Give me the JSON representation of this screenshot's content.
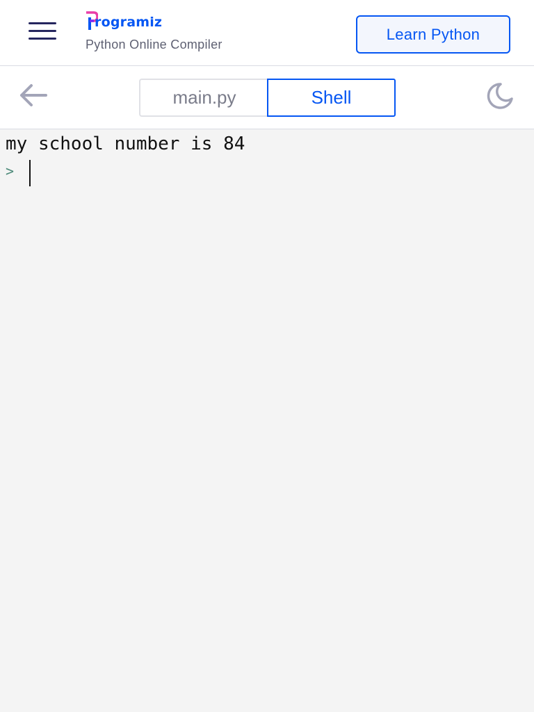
{
  "header": {
    "logo_text": "rogramiz",
    "subtitle": "Python Online Compiler",
    "learn_button": "Learn Python",
    "brand_color": "#0556f3",
    "menu_icon": "hamburger-icon"
  },
  "toolbar": {
    "back_icon": "arrow-left-icon",
    "tabs": [
      {
        "label": "main.py",
        "active": false
      },
      {
        "label": "Shell",
        "active": true
      }
    ],
    "theme_icon": "moon-icon"
  },
  "shell": {
    "output": "my school number is 84",
    "prompt": ">",
    "input_value": ""
  }
}
